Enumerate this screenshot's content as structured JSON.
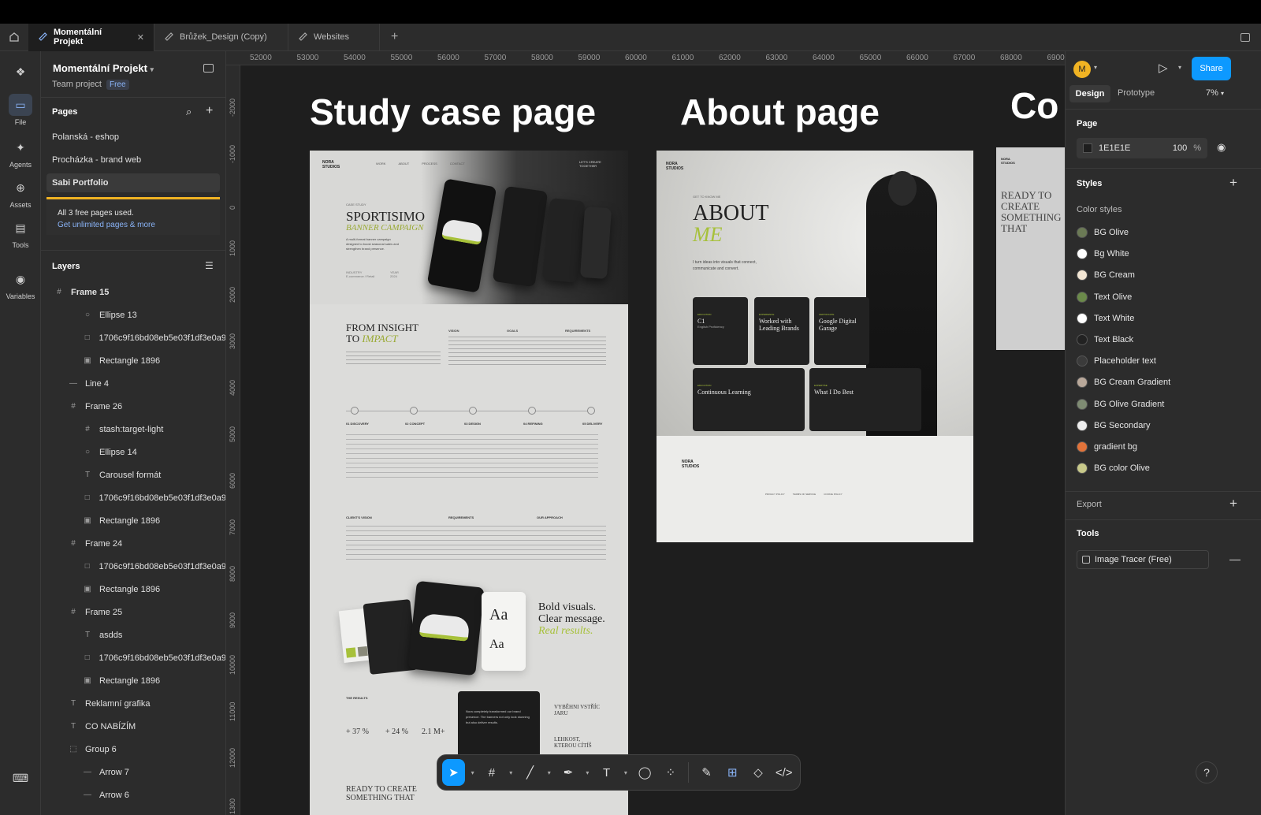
{
  "tabs": [
    {
      "label": "Momentální Projekt",
      "active": true
    },
    {
      "label": "Brůžek_Design (Copy)",
      "active": false
    },
    {
      "label": "Websites",
      "active": false
    }
  ],
  "rail": [
    {
      "label": "File",
      "icon": "file-icon"
    },
    {
      "label": "Agents",
      "icon": "sparkle-icon"
    },
    {
      "label": "Assets",
      "icon": "plus-circle-icon"
    },
    {
      "label": "Tools",
      "icon": "briefcase-icon"
    },
    {
      "label": "Variables",
      "icon": "variables-icon"
    }
  ],
  "project": {
    "name": "Momentální Projekt",
    "team": "Team project",
    "plan": "Free"
  },
  "pages": {
    "title": "Pages",
    "items": [
      "Polanská - eshop",
      "Procházka - brand web",
      "Sabi Portfolio"
    ],
    "selected": "Sabi Portfolio",
    "notice": "All 3 free pages used.",
    "notice_link": "Get unlimited pages & more"
  },
  "layers": {
    "title": "Layers",
    "items": [
      {
        "label": "Frame 15",
        "icon": "frame-icon",
        "indent": 0,
        "bold": true
      },
      {
        "label": "Ellipse 13",
        "icon": "ellipse-icon",
        "indent": 2
      },
      {
        "label": "1706c9f16bd08eb5e03f1df3e0a9",
        "icon": "rectangle-icon",
        "indent": 2
      },
      {
        "label": "Rectangle 1896",
        "icon": "image-icon",
        "indent": 2
      },
      {
        "label": "Line 4",
        "icon": "line-icon",
        "indent": 1
      },
      {
        "label": "Frame 26",
        "icon": "frame-icon",
        "indent": 1
      },
      {
        "label": "stash:target-light",
        "icon": "frame-icon",
        "indent": 2
      },
      {
        "label": "Ellipse 14",
        "icon": "ellipse-icon",
        "indent": 2
      },
      {
        "label": "Carousel formát",
        "icon": "text-icon",
        "indent": 2
      },
      {
        "label": "1706c9f16bd08eb5e03f1df3e0a9",
        "icon": "rectangle-icon",
        "indent": 2
      },
      {
        "label": "Rectangle 1896",
        "icon": "image-icon",
        "indent": 2
      },
      {
        "label": "Frame 24",
        "icon": "frame-icon",
        "indent": 1
      },
      {
        "label": "1706c9f16bd08eb5e03f1df3e0a9",
        "icon": "rectangle-icon",
        "indent": 2
      },
      {
        "label": "Rectangle 1896",
        "icon": "image-icon",
        "indent": 2
      },
      {
        "label": "Frame 25",
        "icon": "frame-icon",
        "indent": 1
      },
      {
        "label": "asdds",
        "icon": "text-icon",
        "indent": 2
      },
      {
        "label": "1706c9f16bd08eb5e03f1df3e0a9",
        "icon": "rectangle-icon",
        "indent": 2
      },
      {
        "label": "Rectangle 1896",
        "icon": "image-icon",
        "indent": 2
      },
      {
        "label": "Reklamní grafika",
        "icon": "text-icon",
        "indent": 1
      },
      {
        "label": "CO NABÍZÍM",
        "icon": "text-icon",
        "indent": 1
      },
      {
        "label": "Group 6",
        "icon": "group-icon",
        "indent": 1
      },
      {
        "label": "Arrow 7",
        "icon": "line-icon",
        "indent": 2
      },
      {
        "label": "Arrow 6",
        "icon": "line-icon",
        "indent": 2
      }
    ]
  },
  "ruler": {
    "top": [
      "52000",
      "53000",
      "54000",
      "55000",
      "56000",
      "57000",
      "58000",
      "59000",
      "60000",
      "61000",
      "62000",
      "63000",
      "64000",
      "65000",
      "66000",
      "67000",
      "68000",
      "69000"
    ],
    "left": [
      "-2000",
      "-1000",
      "0",
      "1000",
      "2000",
      "3000",
      "4000",
      "5000",
      "6000",
      "7000",
      "8000",
      "9000",
      "10000",
      "11000",
      "12000",
      "1300"
    ]
  },
  "canvas": {
    "frames": [
      {
        "title": "Study case page"
      },
      {
        "title": "About page"
      },
      {
        "title": "Co"
      }
    ],
    "study": {
      "brand": "NORA STUDIOS",
      "nav": [
        "WORK",
        "ABOUT",
        "PROCESS",
        "CONTACT"
      ],
      "cta": "LET'S CREATE TOGETHER",
      "kicker": "CASE STUDY",
      "headline": "SPORTISIMO",
      "subhead": "BANNER CAMPAIGN",
      "intro": "A multi-format banner campaign designed to boost seasonal sales and strengthen brand presence.",
      "meta_industry": "INDUSTRY",
      "meta_industry_val": "E-commerce / Retail",
      "meta_year": "YEAR",
      "meta_year_val": "2024",
      "section2": "FROM INSIGHT",
      "section2b": "TO",
      "section2c": "IMPACT",
      "cols": [
        "VISION",
        "GOALS",
        "REQUIREMENTS"
      ],
      "process": [
        "01 DISCOVERY",
        "02 CONCEPT",
        "03 DESIGN",
        "04 REFINING",
        "05 DELIVERY"
      ],
      "vision_blocks": [
        "CLIENT'S VISION",
        "REQUIREMENTS",
        "OUR APPROACH"
      ],
      "aa": "Aa",
      "bold1": "Bold visuals.",
      "bold2": "Clear message.",
      "bold3": "Real results.",
      "results_title": "THE RESULTS",
      "stats": [
        "+ 37 %",
        "+ 24 %",
        "2.1 M+"
      ],
      "quote": "Nora completely transformed our brand presence. The banners not only look stunning but also deliver results.",
      "next1": "VYBĚHNI VSTŘÍC JARU",
      "next2": "LEHKOST, KTEROU CÍTÍŠ",
      "footer": "READY TO CREATE SOMETHING THAT"
    },
    "about": {
      "brand": "NORA STUDIOS",
      "kicker": "GET TO KNOW ME",
      "headline": "ABOUT",
      "headline2": "ME",
      "intro": "I turn ideas into visuals that connect, communicate and convert.",
      "cards": [
        {
          "tag": "EDUCATION",
          "title": "C1",
          "sub": "English Proficiency"
        },
        {
          "tag": "EXPERIENCE",
          "title": "Worked with Leading Brands",
          "sub": ""
        },
        {
          "tag": "CERTIFICATE",
          "title": "Google Digital Garage",
          "sub": ""
        },
        {
          "tag": "EDUCATION",
          "title": "Continuous Learning",
          "sub": ""
        },
        {
          "tag": "EXPERTISE",
          "title": "What I Do Best",
          "sub": ""
        }
      ],
      "footer_brand": "NORA STUDIOS",
      "footer_links": [
        "PRIVACY POLICY",
        "TERMS OF SERVICE",
        "COOKIE POLICY"
      ]
    },
    "contact": {
      "brand": "NORA STUDIOS",
      "headline": "READY TO CREATE SOMETHING THAT"
    }
  },
  "right_panel": {
    "avatar_letter": "M",
    "share": "Share",
    "tabs": [
      "Design",
      "Prototype"
    ],
    "active_tab": "Design",
    "zoom": "7%",
    "page_title": "Page",
    "page_color": "1E1E1E",
    "page_opacity": "100",
    "opacity_unit": "%",
    "styles_title": "Styles",
    "color_styles_title": "Color styles",
    "color_styles": [
      {
        "name": "BG Olive",
        "color": "#6b7a55"
      },
      {
        "name": "Bg White",
        "color": "#ffffff"
      },
      {
        "name": "BG Cream",
        "color": "#f3e6d4"
      },
      {
        "name": "Text Olive",
        "color": "#6b8a4a"
      },
      {
        "name": "Text White",
        "color": "#ffffff"
      },
      {
        "name": "Text Black",
        "color": "#222222"
      },
      {
        "name": "Placeholder text",
        "color": "#3b3b3b"
      },
      {
        "name": "BG Cream Gradient",
        "color": "#b9a89a"
      },
      {
        "name": "BG Olive Gradient",
        "color": "#7f8c73"
      },
      {
        "name": "BG Secondary",
        "color": "#eeeeee"
      },
      {
        "name": "gradient bg",
        "color": "#e2733a"
      },
      {
        "name": "BG color Olive",
        "color": "#c8c98a"
      }
    ],
    "export_title": "Export",
    "tools_title": "Tools",
    "tool_item": "Image Tracer (Free)"
  },
  "toolbar": [
    "move-tool",
    "frame-tool",
    "line-tool",
    "pen-tool",
    "text-tool",
    "comment-tool",
    "actions-tool",
    "draw-mode",
    "design-mode",
    "component-mode",
    "dev-mode"
  ],
  "help": "?"
}
